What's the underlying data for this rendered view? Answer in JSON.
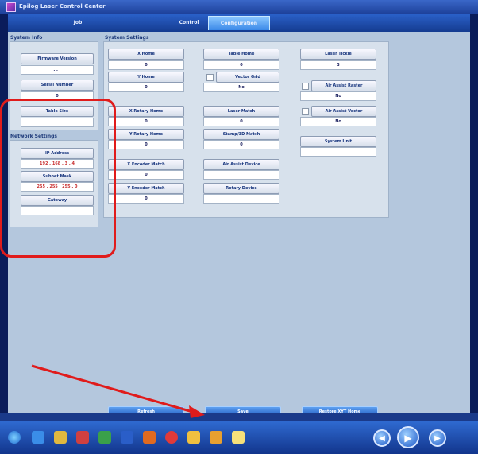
{
  "window": {
    "title": "Epilog Laser Control Center"
  },
  "tabs": [
    {
      "label": "Job"
    },
    {
      "label": "Control"
    },
    {
      "label": "Configuration"
    }
  ],
  "system_info": {
    "title": "System Info",
    "firmware_version_label": "Firmware Version",
    "firmware_version_value": ". . .",
    "serial_number_label": "Serial Number",
    "serial_number_value": "0",
    "table_size_label": "Table Size",
    "table_size_value": ""
  },
  "network_settings": {
    "title": "Network Settings",
    "ip_label": "IP Address",
    "ip_value": "192 . 168 . 3 . 4",
    "subnet_label": "Subnet Mask",
    "subnet_value": "255 . 255 . 255 . 0",
    "gateway_label": "Gateway",
    "gateway_value": ". . ."
  },
  "system_settings": {
    "title": "System Settings",
    "x_home_label": "X Home",
    "x_home_value": "0",
    "y_home_label": "Y Home",
    "y_home_value": "0",
    "x_rotary_home_label": "X Rotary Home",
    "x_rotary_home_value": "0",
    "y_rotary_home_label": "Y Rotary Home",
    "y_rotary_home_value": "0",
    "x_encoder_label": "X Encoder Match",
    "x_encoder_value": "0",
    "y_encoder_label": "Y Encoder Match",
    "y_encoder_value": "0",
    "table_home_label": "Table Home",
    "table_home_value": "0",
    "vector_grid_label": "Vector Grid",
    "vector_grid_value": "No",
    "laser_match_label": "Laser Match",
    "laser_match_value": "0",
    "stamp_3d_label": "Stamp/3D Match",
    "stamp_3d_value": "0",
    "air_assist_device_label": "Air Assist Device",
    "air_assist_device_value": "",
    "rotary_device_label": "Rotary Device",
    "rotary_device_value": "",
    "laser_tickle_label": "Laser Tickle",
    "laser_tickle_value": "3",
    "air_assist_raster_label": "Air Assist Raster",
    "air_assist_raster_value": "No",
    "air_assist_vector_label": "Air Assist Vector",
    "air_assist_vector_value": "No",
    "system_unit_label": "System Unit",
    "system_unit_value": ""
  },
  "actions": {
    "refresh": "Refresh",
    "save": "Save",
    "restore": "Restore XYT Home"
  },
  "colors": {
    "annotation": "#e01b1b",
    "panel": "#b4c7dd",
    "taskbar": "#2f6ad0"
  },
  "taskbar_icons": [
    "start-orb-icon",
    "internet-explorer-icon",
    "file-explorer-icon",
    "pdf-icon",
    "spreadsheet-icon",
    "word-icon",
    "app-icon",
    "media-icon",
    "paint-icon",
    "folder-icon",
    "notes-icon"
  ],
  "media_controls": [
    "previous-icon",
    "play-icon",
    "next-icon"
  ]
}
